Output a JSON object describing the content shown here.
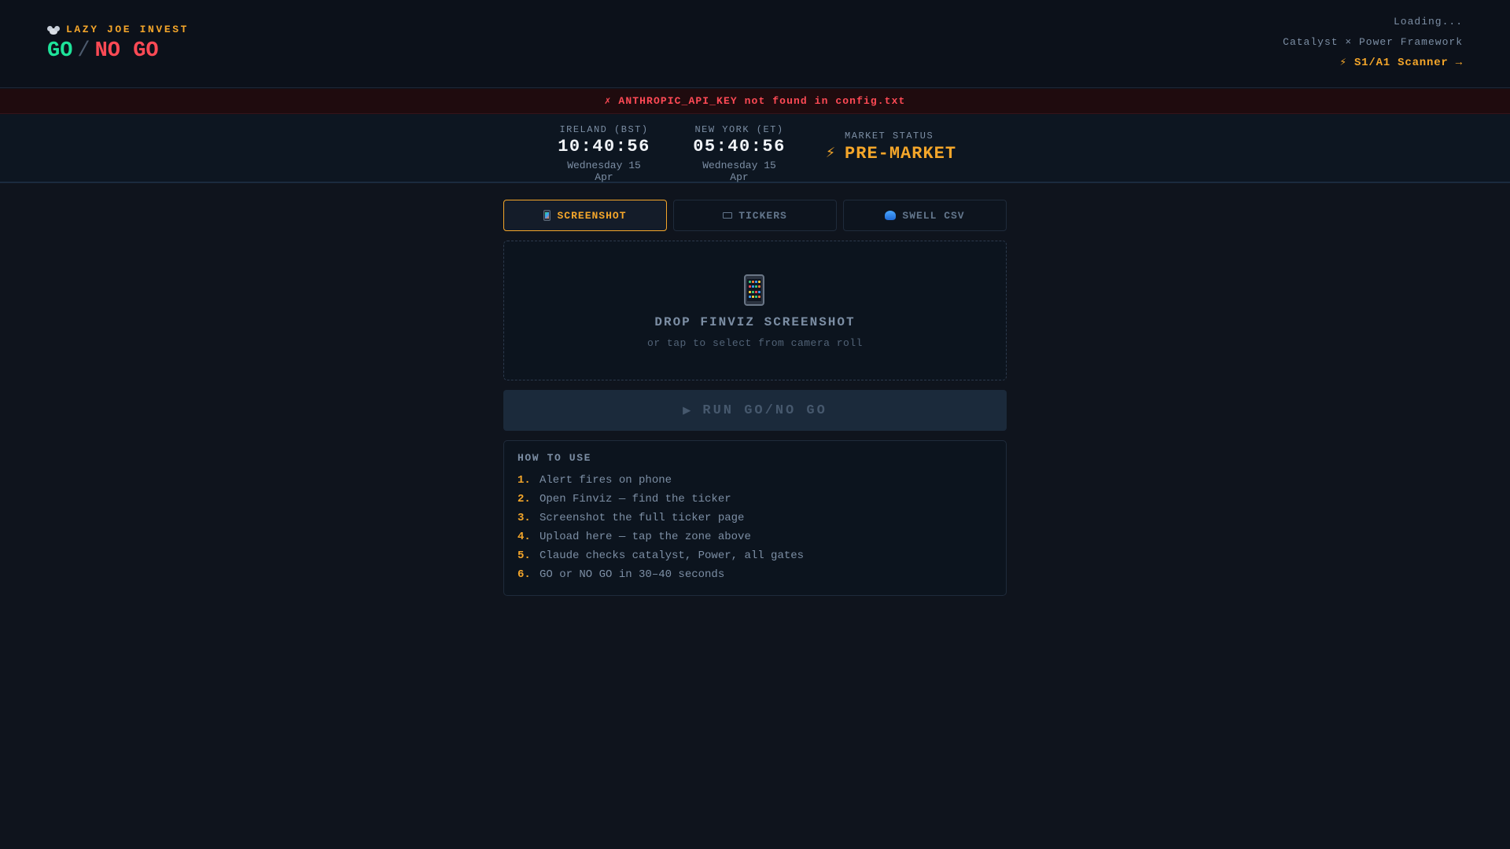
{
  "header": {
    "brand": "LAZY JOE INVEST",
    "brand_icon": "mouse-face-icon",
    "title_go": "GO",
    "title_sep": "/",
    "title_nogo": "NO GO",
    "loading": "Loading...",
    "framework": "Catalyst × Power Framework",
    "scanner_link": "⚡ S1/A1 Scanner →"
  },
  "error_banner": {
    "text": "✗ ANTHROPIC_API_KEY not found in config.txt"
  },
  "clocks": {
    "ireland": {
      "label": "IRELAND (BST)",
      "time": "10:40:56",
      "date": "Wednesday 15 Apr"
    },
    "new_york": {
      "label": "NEW YORK (ET)",
      "time": "05:40:56",
      "date": "Wednesday 15 Apr"
    },
    "market": {
      "icon": "⚡",
      "label": "MARKET STATUS",
      "value": "PRE-MARKET"
    }
  },
  "tabs": [
    {
      "label": "SCREENSHOT",
      "icon": "phone-icon",
      "active": true
    },
    {
      "label": "TICKERS",
      "icon": "keyboard-icon",
      "active": false
    },
    {
      "label": "SWELL CSV",
      "icon": "wave-icon",
      "active": false
    }
  ],
  "dropzone": {
    "icon": "phone-icon",
    "title": "DROP FINVIZ SCREENSHOT",
    "subtitle": "or tap to select from camera roll"
  },
  "run_button": {
    "icon": "▶",
    "label": "RUN GO/NO GO"
  },
  "howto": {
    "title": "HOW TO USE",
    "steps": [
      {
        "num": "1.",
        "text": "Alert fires on phone"
      },
      {
        "num": "2.",
        "text": "Open Finviz — find the ticker"
      },
      {
        "num": "3.",
        "text": "Screenshot the full ticker page"
      },
      {
        "num": "4.",
        "text": "Upload here — tap the zone above"
      },
      {
        "num": "5.",
        "text": "Claude checks catalyst, Power, all gates"
      },
      {
        "num": "6.",
        "text": "GO or NO GO in 30–40 seconds"
      }
    ]
  },
  "colors": {
    "accent": "#f4a62a",
    "go": "#1ee39a",
    "nogo": "#ff4a55",
    "background": "#0f141d"
  }
}
